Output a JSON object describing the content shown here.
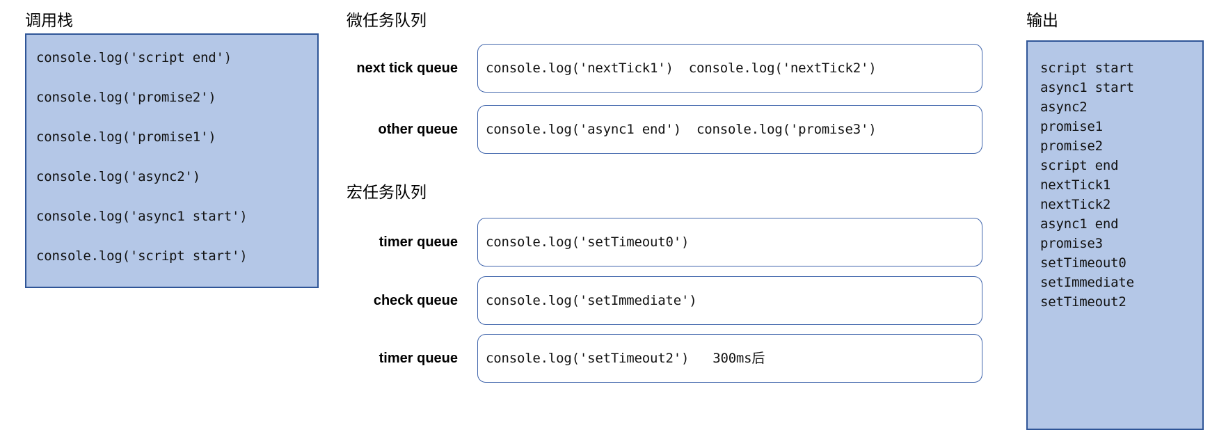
{
  "call_stack": {
    "title": "调用栈",
    "frames": [
      "console.log('script end')",
      "console.log('promise2')",
      "console.log('promise1')",
      "console.log('async2')",
      "console.log('async1 start')",
      "console.log('script start')"
    ]
  },
  "microtask": {
    "title": "微任务队列",
    "rows": [
      {
        "label": "next tick queue",
        "items": [
          "console.log('nextTick1')",
          "console.log('nextTick2')"
        ],
        "note": ""
      },
      {
        "label": "other queue",
        "items": [
          "console.log('async1 end')",
          "console.log('promise3')"
        ],
        "note": ""
      }
    ]
  },
  "macrotask": {
    "title": "宏任务队列",
    "rows": [
      {
        "label": "timer queue",
        "items": [
          "console.log('setTimeout0')"
        ],
        "note": ""
      },
      {
        "label": "check queue",
        "items": [
          "console.log('setImmediate')"
        ],
        "note": ""
      },
      {
        "label": "timer queue",
        "items": [
          "console.log('setTimeout2')"
        ],
        "note": "300ms后"
      }
    ]
  },
  "output": {
    "title": "输出",
    "lines": [
      "script start",
      "async1 start",
      "async2",
      "promise1",
      "promise2",
      "script end",
      "nextTick1",
      "nextTick2",
      "async1 end",
      "promise3",
      "setTimeout0",
      "setImmediate",
      "setTimeout2"
    ]
  },
  "colors": {
    "panel_fill": "#b4c7e7",
    "panel_border": "#2f5597",
    "box_border": "#3f64ab",
    "text": "#111111"
  }
}
